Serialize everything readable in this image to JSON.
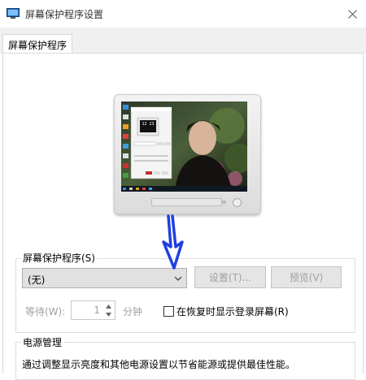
{
  "window": {
    "title": "屏幕保护程序设置",
    "close_icon": "close-icon",
    "app_icon": "screensaver-app-icon"
  },
  "tabs": [
    {
      "label": "屏幕保护程序"
    }
  ],
  "preview": {
    "icon": "monitor-preview",
    "clock_text": "12 23"
  },
  "screensaver": {
    "group_label": "屏幕保护程序(S)",
    "selected": "(无)",
    "settings_button": "设置(T)...",
    "preview_button": "预览(V)",
    "wait_label": "等待(W):",
    "wait_value": "1",
    "wait_unit": "分钟",
    "resume_checkbox_label": "在恢复时显示登录屏幕(R)",
    "resume_checked": false
  },
  "power": {
    "group_label": "电源管理",
    "description": "通过调整显示亮度和其他电源设置以节省能源或提供最佳性能。"
  },
  "annotation": {
    "arrow_color": "#1f3fe0"
  }
}
